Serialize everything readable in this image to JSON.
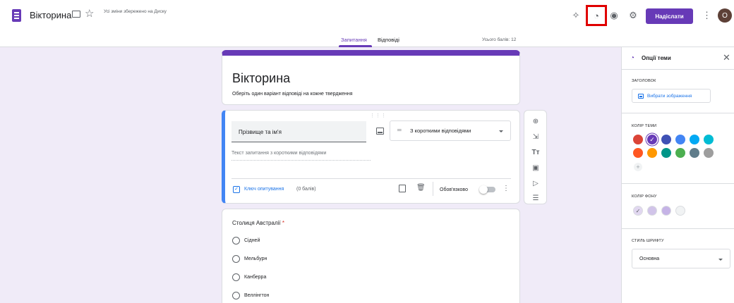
{
  "app": {
    "title": "Вікторина",
    "save_status": "Усі зміни збережено на Диску",
    "send_label": "Надіслати",
    "avatar_letter": "O",
    "accent": "#673ab7"
  },
  "toolbar_icons": [
    "addons-icon",
    "palette-icon",
    "preview-eye-icon",
    "settings-gear-icon",
    "more-vert-icon"
  ],
  "tabs": [
    {
      "label": "Запитання",
      "active": true
    },
    {
      "label": "Відповіді",
      "active": false
    }
  ],
  "total_points": "Усього балів: 12",
  "form": {
    "title": "Вікторина",
    "description": "Оберіть один варіант відповіді на кожне твердження"
  },
  "active_question": {
    "title": "Прізвище та ім'я",
    "type": "З короткими відповідями",
    "answer_placeholder": "Текст запитання з короткими відповідями",
    "answer_key": "Ключ опитування",
    "points": "(0 балів)",
    "required_label": "Обов'язково",
    "required": false
  },
  "question2": {
    "title": "Столиця Австралії",
    "required_mark": "*",
    "options": [
      "Сідней",
      "Мельбурн",
      "Канберра",
      "Веллінгтон"
    ]
  },
  "side_toolbar_icons": [
    "add-question-icon",
    "import-questions-icon",
    "add-title-icon",
    "add-image-icon",
    "add-video-icon",
    "add-section-icon"
  ],
  "theme_panel": {
    "title": "Опції теми",
    "header_label": "ЗАГОЛОВОК",
    "choose_image": "Вибрати зображення",
    "theme_color_label": "КОЛІР ТЕМИ",
    "theme_colors": [
      "#db4437",
      "#673ab7",
      "#3f51b5",
      "#4285f4",
      "#03a9f4",
      "#00bcd4",
      "#ff5722",
      "#ff9800",
      "#009688",
      "#4caf50",
      "#607d8b",
      "#9e9e9e"
    ],
    "selected_theme_color": "#673ab7",
    "add_color": "+",
    "background_label": "КОЛІР ФОНУ",
    "background_colors": [
      "#e1d7f0",
      "#d1c4e9",
      "#c5b3e6",
      "#f1f3f4"
    ],
    "font_style_label": "СТИЛЬ ШРИФТУ",
    "font_style": "Основна"
  }
}
